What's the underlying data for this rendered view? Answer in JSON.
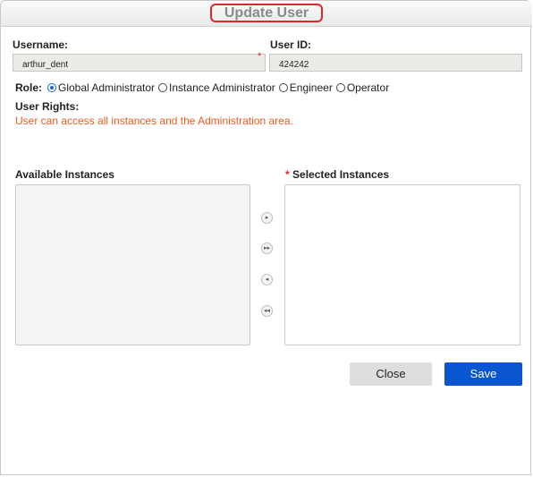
{
  "dialog": {
    "title": "Update User"
  },
  "username": {
    "label": "Username:",
    "value": "arthur_dent",
    "required_mark": "*"
  },
  "user_id": {
    "label": "User ID:",
    "value": "424242"
  },
  "role": {
    "label": "Role:",
    "options": [
      {
        "label": "Global Administrator",
        "selected": true
      },
      {
        "label": "Instance Administrator",
        "selected": false
      },
      {
        "label": "Engineer",
        "selected": false
      },
      {
        "label": "Operator",
        "selected": false
      }
    ]
  },
  "user_rights": {
    "label": "User Rights:",
    "text": "User can access all instances and the Administration area.",
    "color": "#f05a1e"
  },
  "available_instances": {
    "label": "Available Instances"
  },
  "selected_instances": {
    "label": "Selected Instances",
    "required_mark": "*"
  },
  "mover_buttons": [
    {
      "icon": "move-right-icon"
    },
    {
      "icon": "move-all-right-icon"
    },
    {
      "icon": "move-left-icon"
    },
    {
      "icon": "move-all-left-icon"
    }
  ],
  "buttons": {
    "close_label": "Close",
    "save_label": "Save"
  },
  "colors": {
    "accent": "#0a56d0",
    "required": "#e0262a"
  }
}
